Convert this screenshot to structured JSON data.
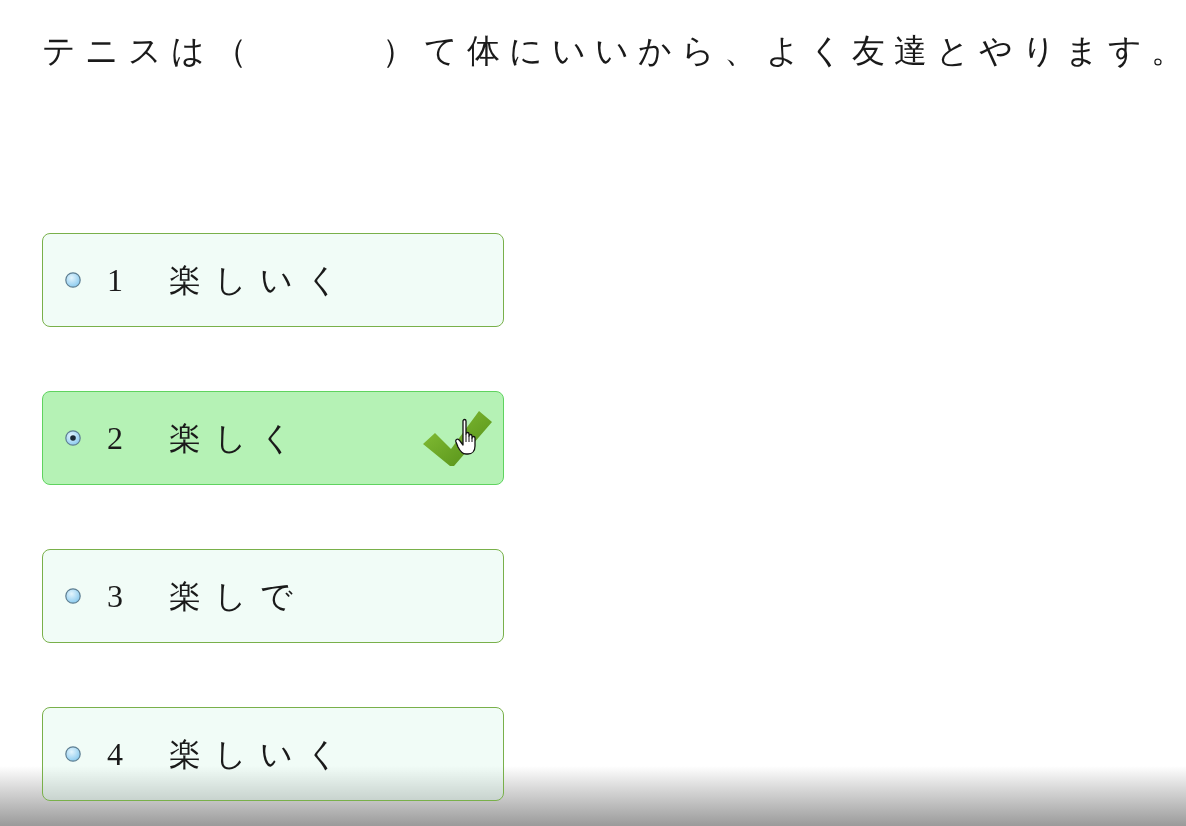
{
  "question": {
    "text": "テニスは（　　　）て体にいいから、よく友達とやります。"
  },
  "options": [
    {
      "number": "1",
      "text": "楽しいく",
      "selected": false
    },
    {
      "number": "2",
      "text": "楽しく",
      "selected": true
    },
    {
      "number": "3",
      "text": "楽しで",
      "selected": false
    },
    {
      "number": "4",
      "text": "楽しいく",
      "selected": false
    }
  ]
}
